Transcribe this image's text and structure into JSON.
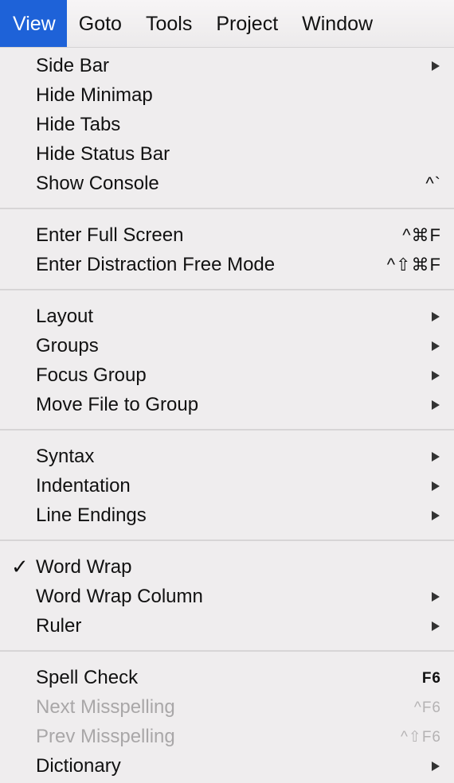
{
  "menubar": {
    "items": [
      {
        "label": "View",
        "active": true
      },
      {
        "label": "Goto"
      },
      {
        "label": "Tools"
      },
      {
        "label": "Project"
      },
      {
        "label": "Window"
      }
    ]
  },
  "menu": {
    "group1": [
      {
        "label": "Side Bar",
        "submenu": true
      },
      {
        "label": "Hide Minimap"
      },
      {
        "label": "Hide Tabs"
      },
      {
        "label": "Hide Status Bar"
      },
      {
        "label": "Show Console",
        "shortcut": "^`"
      }
    ],
    "group2": [
      {
        "label": "Enter Full Screen",
        "shortcut": "^⌘F"
      },
      {
        "label": "Enter Distraction Free Mode",
        "shortcut": "^⇧⌘F"
      }
    ],
    "group3": [
      {
        "label": "Layout",
        "submenu": true
      },
      {
        "label": "Groups",
        "submenu": true
      },
      {
        "label": "Focus Group",
        "submenu": true
      },
      {
        "label": "Move File to Group",
        "submenu": true
      }
    ],
    "group4": [
      {
        "label": "Syntax",
        "submenu": true
      },
      {
        "label": "Indentation",
        "submenu": true
      },
      {
        "label": "Line Endings",
        "submenu": true
      }
    ],
    "group5": [
      {
        "label": "Word Wrap",
        "checked": true,
        "check_mark": "✓"
      },
      {
        "label": "Word Wrap Column",
        "submenu": true
      },
      {
        "label": "Ruler",
        "submenu": true
      }
    ],
    "group6": [
      {
        "label": "Spell Check",
        "shortcut": "F6"
      },
      {
        "label": "Next Misspelling",
        "shortcut": "^F6",
        "disabled": true
      },
      {
        "label": "Prev Misspelling",
        "shortcut": "^⇧F6",
        "disabled": true
      },
      {
        "label": "Dictionary",
        "submenu": true
      }
    ]
  },
  "colors": {
    "menubar_active_bg": "#1e62d8",
    "menu_bg": "#efedee",
    "disabled_text": "#a9a7a8",
    "separator": "#d7d5d6"
  }
}
